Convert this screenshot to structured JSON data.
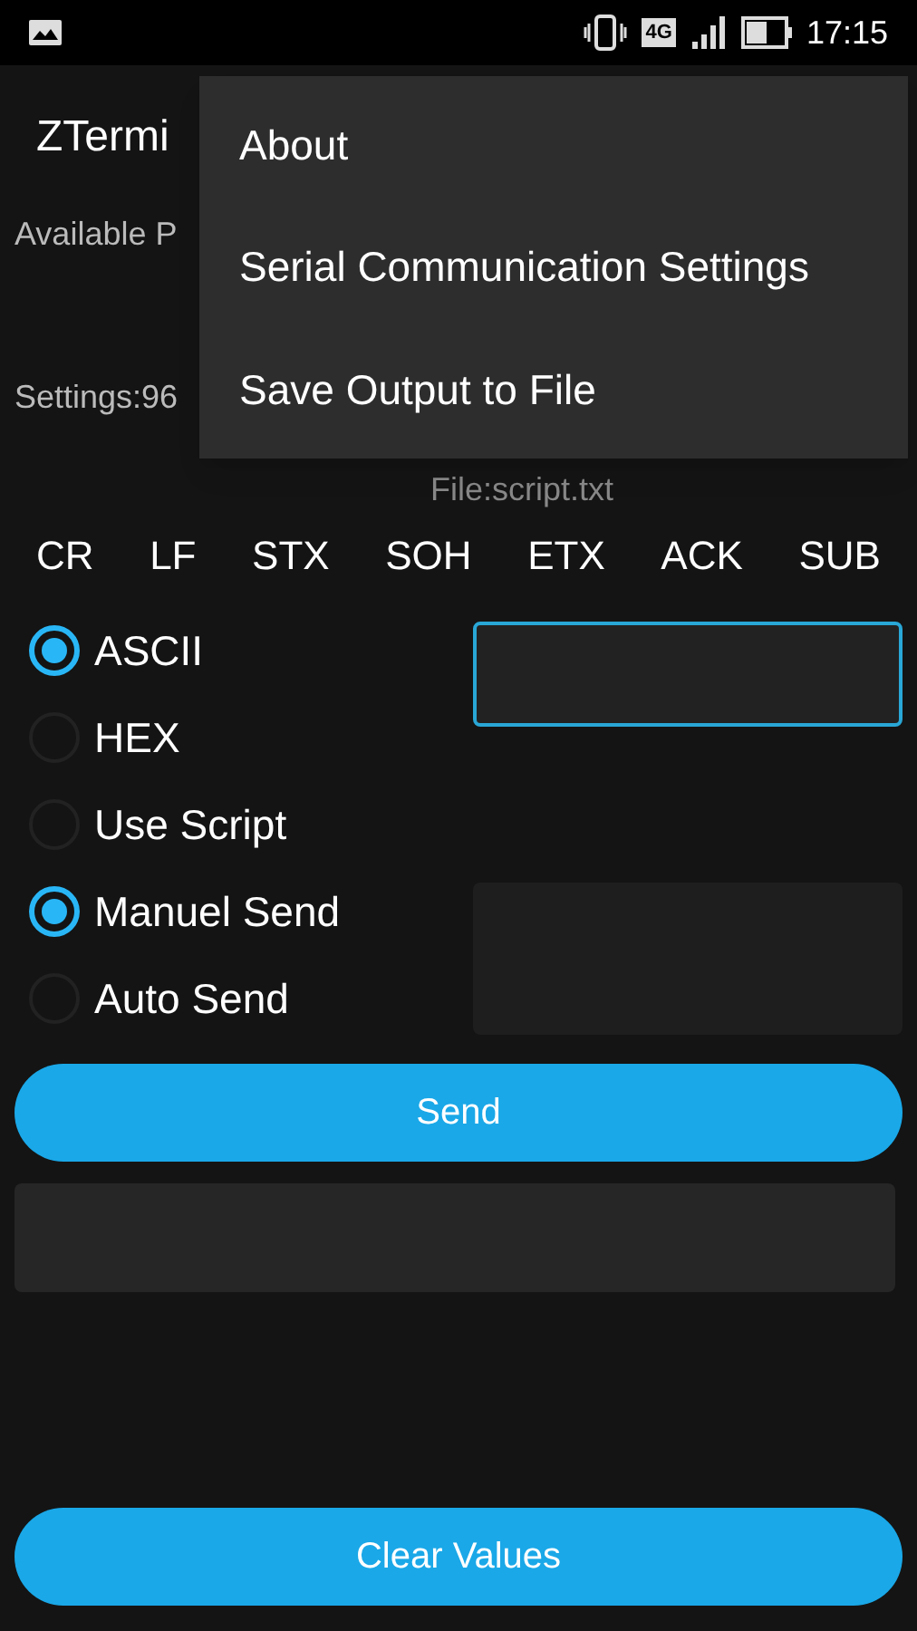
{
  "status_bar": {
    "network": "4G",
    "time": "17:15"
  },
  "app_title": "ZTermi",
  "available_label": "Available P",
  "settings_label": "Settings:96",
  "file_label": "File:script.txt",
  "control_chars": [
    "CR",
    "LF",
    "STX",
    "SOH",
    "ETX",
    "ACK",
    "SUB"
  ],
  "format_options": [
    {
      "label": "ASCII",
      "selected": true
    },
    {
      "label": "HEX",
      "selected": false
    },
    {
      "label": "Use Script",
      "selected": false
    }
  ],
  "send_mode_options": [
    {
      "label": "Manuel Send",
      "selected": true
    },
    {
      "label": "Auto Send",
      "selected": false
    }
  ],
  "send_button": "Send",
  "clear_button": "Clear Values",
  "menu": [
    "About",
    "Serial Communication Settings",
    "Save Output to File"
  ]
}
